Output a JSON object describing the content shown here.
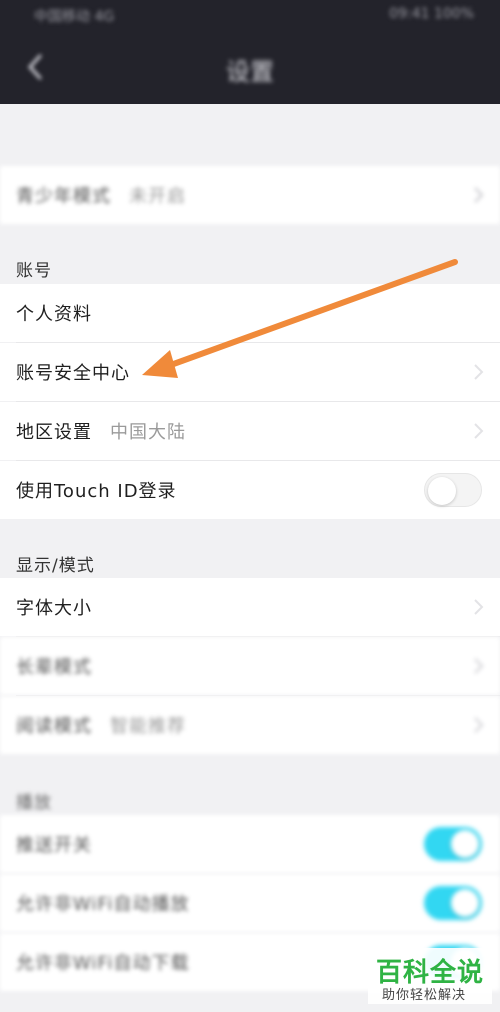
{
  "status_bar": {
    "left": "中国移动 4G",
    "right": "09:41 100%"
  },
  "nav": {
    "title": "设置",
    "back_icon": "chevron-left-icon"
  },
  "rows": {
    "teen_mode": {
      "label": "青少年模式",
      "value": "未开启"
    },
    "account_section": "账号",
    "profile": {
      "label": "个人资料"
    },
    "security": {
      "label": "账号安全中心"
    },
    "region": {
      "label": "地区设置",
      "value": "中国大陆"
    },
    "touch_id": {
      "label": "使用Touch ID登录",
      "enabled": false
    },
    "display_section": "显示/模式",
    "font_size": {
      "label": "字体大小"
    },
    "elder_mode": {
      "label": "长辈模式"
    },
    "read_mode": {
      "label": "阅读模式",
      "value": "智能推荐"
    },
    "other_section": "播放",
    "setting_a": {
      "label": "推送开关",
      "enabled": true
    },
    "setting_b": {
      "label": "允许非WiFi自动播放",
      "enabled": true
    },
    "setting_c": {
      "label": "允许非WiFi自动下载",
      "enabled": true
    }
  },
  "annotation": {
    "icon": "orange-arrow-icon",
    "color": "#f08a3a"
  },
  "watermark": {
    "title": "百科全说",
    "subtitle": "助你轻松解决",
    "color": "#2fb344"
  }
}
